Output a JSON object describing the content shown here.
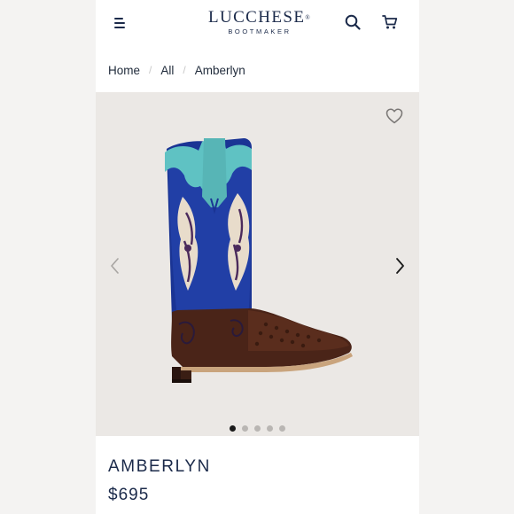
{
  "brand": {
    "name": "LUCCHESE",
    "tagline": "BOOTMAKER",
    "trademark": "®"
  },
  "header": {
    "menu_icon": "hamburger-menu-icon",
    "search_icon": "search-icon",
    "cart_icon": "shopping-cart-icon"
  },
  "breadcrumb": {
    "items": [
      "Home",
      "All",
      "Amberlyn"
    ],
    "separator": "/"
  },
  "gallery": {
    "image_count": 5,
    "active_index": 0,
    "favorite_icon": "heart-icon",
    "prev_icon": "chevron-left-icon",
    "next_icon": "chevron-right-icon"
  },
  "product": {
    "name": "AMBERLYN",
    "price": "$695"
  },
  "colors": {
    "navy": "#1b2a4a",
    "gallery_bg": "#ebe8e5",
    "boot_blue": "#1f3fa0",
    "boot_turquoise": "#5fc2c3",
    "boot_brown": "#4a2418"
  }
}
